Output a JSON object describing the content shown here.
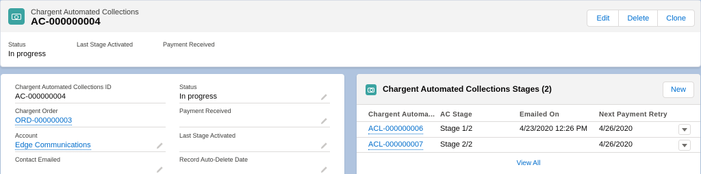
{
  "header": {
    "object_type": "Chargent Automated Collections",
    "record_name": "AC-000000004",
    "icon": "money-icon",
    "buttons": {
      "edit": "Edit",
      "delete": "Delete",
      "clone": "Clone"
    },
    "highlights": [
      {
        "label": "Status",
        "value": "In progress"
      },
      {
        "label": "Last Stage Activated",
        "value": ""
      },
      {
        "label": "Payment Received",
        "value": ""
      }
    ]
  },
  "detail": {
    "fields": [
      {
        "label": "Chargent Automated Collections ID",
        "value": "AC-000000004"
      },
      {
        "label": "Status",
        "value": "In progress"
      },
      {
        "label": "Chargent Order",
        "value": "ORD-000000003"
      },
      {
        "label": "Payment Received",
        "value": ""
      },
      {
        "label": "Account",
        "value": "Edge Communications"
      },
      {
        "label": "Last Stage Activated",
        "value": ""
      },
      {
        "label": "Contact Emailed",
        "value": ""
      },
      {
        "label": "Record Auto-Delete Date",
        "value": ""
      }
    ]
  },
  "related": {
    "title": "Chargent Automated Collections Stages (2)",
    "new_label": "New",
    "columns": [
      "Chargent Automa...",
      "AC Stage",
      "Emailed On",
      "Next Payment Retry"
    ],
    "rows": [
      {
        "name": "ACL-000000006",
        "stage": "Stage 1/2",
        "emailed_on": "4/23/2020 12:26 PM",
        "next_retry": "4/26/2020"
      },
      {
        "name": "ACL-000000007",
        "stage": "Stage 2/2",
        "emailed_on": "",
        "next_retry": "4/26/2020"
      }
    ],
    "view_all": "View All"
  },
  "colors": {
    "page_bg": "#b0c4df",
    "icon_teal": "#3ba3a1",
    "link_blue": "#006dcc"
  }
}
